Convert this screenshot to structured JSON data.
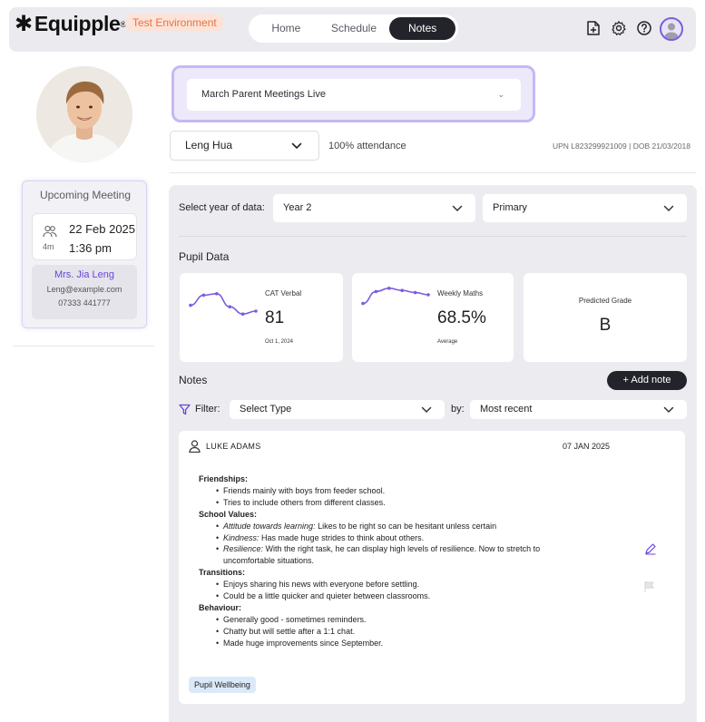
{
  "app": {
    "logo": "Equipple",
    "environment_badge": "Test Environment",
    "nav_tabs": [
      "Home",
      "Schedule",
      "Notes"
    ],
    "active_tab": "Notes",
    "accent": "#7c5ce0"
  },
  "sidebar": {
    "upcoming_title": "Upcoming Meeting",
    "meeting_duration": "4m",
    "meeting_date": "22 Feb 2025",
    "meeting_time": "1:36 pm",
    "contact_name": "Mrs. Jia Leng",
    "contact_email": "Leng@example.com",
    "contact_phone": "07333 441777"
  },
  "header": {
    "meeting_select": "March Parent Meetings Live",
    "pupil_select": "Leng Hua",
    "attendance": "100% attendance",
    "upn_dob": "UPN L823299921009 | DOB 21/03/2018"
  },
  "filters": {
    "year_label": "Select year of data:",
    "year_value": "Year 2",
    "phase_value": "Primary"
  },
  "pupil_data": {
    "section_title": "Pupil Data",
    "cards": [
      {
        "label": "CAT Verbal",
        "value": "81",
        "sub": "Oct 1, 2024",
        "sparkline": [
          0.55,
          0.2,
          0.15,
          0.6,
          0.85,
          0.75
        ]
      },
      {
        "label": "Weekly Maths",
        "value": "68.5%",
        "sub": "Average",
        "sparkline": [
          0.9,
          0.35,
          0.2,
          0.3,
          0.4,
          0.5
        ]
      },
      {
        "label": "Predicted Grade",
        "value": "B"
      }
    ]
  },
  "notes": {
    "section_title": "Notes",
    "add_label": "+ Add note",
    "filter_label": "Filter:",
    "type_select": "Select Type",
    "by_label": "by:",
    "sort_select": "Most recent",
    "items": [
      {
        "author": "LUKE ADAMS",
        "date": "07 JAN 2025",
        "sections": [
          {
            "heading": "Friendships:",
            "points": [
              {
                "text": "Friends mainly with boys from feeder school."
              },
              {
                "text": "Tries to include others from different classes."
              }
            ]
          },
          {
            "heading": "School Values:",
            "points": [
              {
                "em": "Attitude towards learning:",
                "text": " Likes to be right so can be hesitant unless certain"
              },
              {
                "em": "Kindness:",
                "text": " Has made huge strides to think about others."
              },
              {
                "em": "Resilience:",
                "text": " With the right task, he can display high levels of resilience. Now to stretch to uncomfortable situations."
              }
            ]
          },
          {
            "heading": "Transitions:",
            "points": [
              {
                "text": "Enjoys sharing his news with everyone before settling."
              },
              {
                "text": "Could be a little quicker and quieter between classrooms."
              }
            ]
          },
          {
            "heading": "Behaviour:",
            "points": [
              {
                "text": "Generally good - sometimes reminders."
              },
              {
                "text": "Chatty but will settle after a 1:1 chat."
              },
              {
                "text": "Made huge improvements since September."
              }
            ]
          }
        ],
        "tag": "Pupil Wellbeing"
      }
    ]
  }
}
